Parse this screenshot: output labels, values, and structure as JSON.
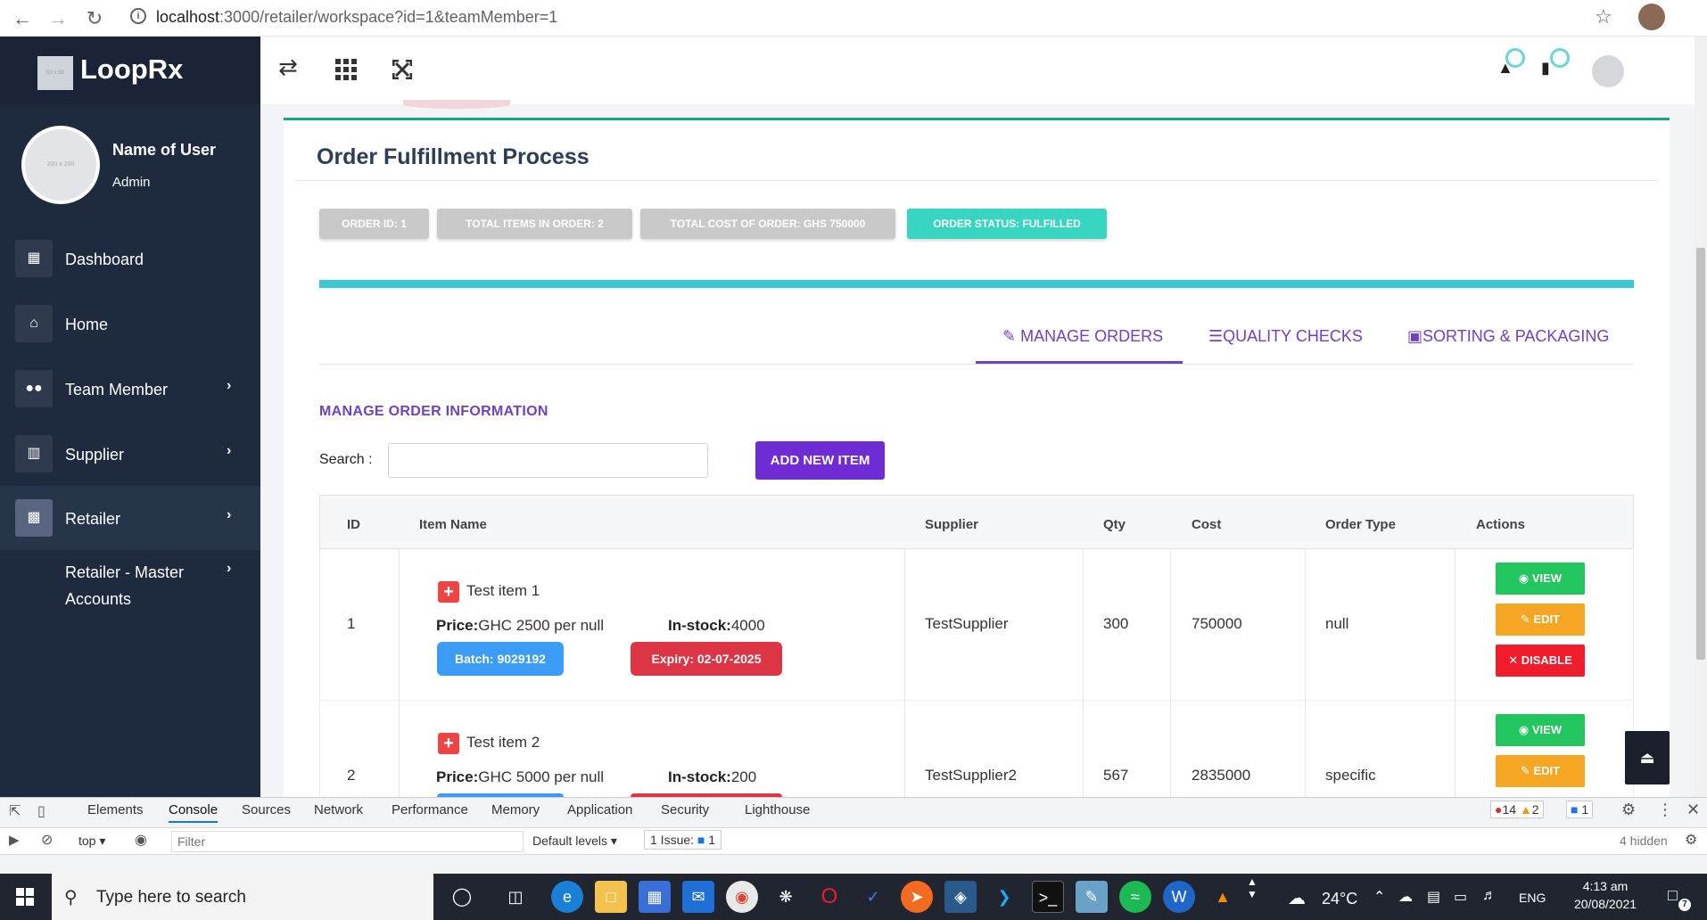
{
  "browser": {
    "url_host": "localhost",
    "url_path": ":3000/retailer/workspace?id=1&teamMember=1"
  },
  "sidebar": {
    "brand": "LoopRx",
    "logo_placeholder": "50 x 50",
    "avatar_placeholder": "200 x 200",
    "user_name": "Name of User",
    "user_role": "Admin",
    "items": [
      {
        "label": "Dashboard"
      },
      {
        "label": "Home"
      },
      {
        "label": "Team Member"
      },
      {
        "label": "Supplier"
      },
      {
        "label": "Retailer"
      },
      {
        "label": "Retailer - Master",
        "label2": "Accounts"
      }
    ]
  },
  "page": {
    "title": "Order Fulfillment Process",
    "pills": {
      "order_id": "ORDER ID: 1",
      "total_items": "TOTAL ITEMS IN ORDER: 2",
      "total_cost": "TOTAL COST OF ORDER: GHS 750000",
      "status": "ORDER STATUS: FULFILLED"
    },
    "tabs": {
      "manage": "MANAGE ORDERS",
      "quality": "QUALITY CHECKS",
      "sorting": "SORTING & PACKAGING"
    },
    "section_title": "MANAGE ORDER INFORMATION",
    "search_label": "Search :",
    "search_value": "",
    "add_button": "ADD NEW ITEM"
  },
  "table": {
    "headers": {
      "id": "ID",
      "item_name": "Item Name",
      "supplier": "Supplier",
      "qty": "Qty",
      "cost": "Cost",
      "order_type": "Order Type",
      "actions": "Actions"
    },
    "rows": [
      {
        "id": "1",
        "item": "Test item 1",
        "price_label": "Price:",
        "price": "GHC 2500 per null",
        "stock_label": "In-stock:",
        "stock": "4000",
        "batch": "Batch: 9029192",
        "expiry": "Expiry: 02-07-2025",
        "supplier": "TestSupplier",
        "qty": "300",
        "cost": "750000",
        "order_type": "null"
      },
      {
        "id": "2",
        "item": "Test item 2",
        "price_label": "Price:",
        "price": "GHC 5000 per null",
        "stock_label": "In-stock:",
        "stock": "200",
        "supplier": "TestSupplier2",
        "qty": "567",
        "cost": "2835000",
        "order_type": "specific"
      }
    ],
    "actions": {
      "view": "VIEW",
      "edit": "EDIT",
      "disable": "DISABLE"
    }
  },
  "devtools": {
    "tabs": [
      "Elements",
      "Console",
      "Sources",
      "Network",
      "Performance",
      "Memory",
      "Application",
      "Security",
      "Lighthouse"
    ],
    "errors": "14",
    "warnings": "2",
    "messages": "1",
    "context": "top",
    "filter_placeholder": "Filter",
    "levels": "Default levels",
    "issues_label": "1 Issue:",
    "issues_count": "1",
    "hidden": "4 hidden"
  },
  "taskbar": {
    "search_placeholder": "Type here to search",
    "weather": "24°C",
    "lang": "ENG",
    "time": "4:13 am",
    "date": "20/08/2021",
    "notifications": "7"
  },
  "colors": {
    "sidebar": "#1e2a3e",
    "accent_purple": "#6f42c1",
    "teal": "#38d6c0",
    "progress": "#3cc8d2"
  }
}
